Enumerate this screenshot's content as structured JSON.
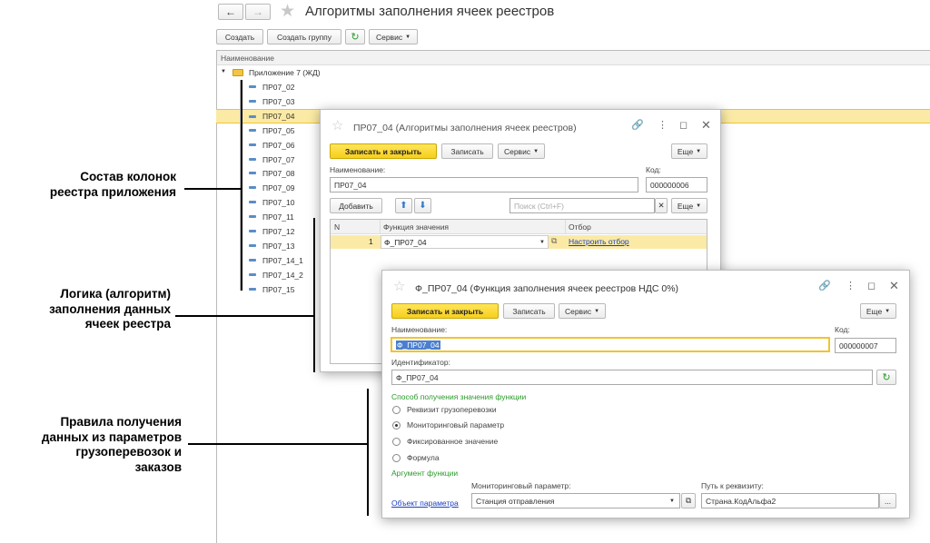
{
  "main": {
    "title": "Алгоритмы заполнения ячеек реестров",
    "buttons": {
      "create": "Создать",
      "create_group": "Создать группу",
      "service": "Сервис"
    },
    "column_header": "Наименование",
    "group_label": "Приложение 7 (ЖД)",
    "rows": [
      "ПР07_02",
      "ПР07_03",
      "ПР07_04",
      "ПР07_05",
      "ПР07_06",
      "ПР07_07",
      "ПР07_08",
      "ПР07_09",
      "ПР07_10",
      "ПР07_11",
      "ПР07_12",
      "ПР07_13",
      "ПР07_14_1",
      "ПР07_14_2",
      "ПР07_15"
    ],
    "selected_row": "ПР07_04"
  },
  "captions": {
    "c1": "Состав колонок\nреестра  приложения",
    "c2": "Логика (алгоритм)\nзаполнения данных\nячеек реестра",
    "c3": "Правила получения\nданных из параметров\nгрузоперевозок и\nзаказов"
  },
  "dialog1": {
    "title": "ПР07_04 (Алгоритмы заполнения ячеек реестров)",
    "buttons": {
      "save_close": "Записать и закрыть",
      "save": "Записать",
      "service": "Сервис",
      "more": "Еще",
      "add": "Добавить",
      "more2": "Еще"
    },
    "name_label": "Наименование:",
    "name_value": "ПР07_04",
    "code_label": "Код:",
    "code_value": "000000006",
    "search_placeholder": "Поиск (Ctrl+F)",
    "table": {
      "headers": [
        "N",
        "Функция значения",
        "Отбор"
      ],
      "row": {
        "n": "1",
        "func": "Ф_ПР07_04",
        "filter": "Настроить отбор"
      }
    }
  },
  "dialog2": {
    "title": "Ф_ПР07_04 (Функция заполнения ячеек реестров НДС 0%)",
    "buttons": {
      "save_close": "Записать и закрыть",
      "save": "Записать",
      "service": "Сервис",
      "more": "Еще",
      "params_link": "Объект параметра"
    },
    "name_label": "Наименование:",
    "name_value": "Ф_ПР07_04",
    "code_label": "Код:",
    "code_value": "000000007",
    "id_label": "Идентификатор:",
    "id_value": "Ф_ПР07_04",
    "method_label": "Способ получения значения функции",
    "options": [
      "Реквизит грузоперевозки",
      "Мониторинговый параметр",
      "Фиксированное значение",
      "Формула"
    ],
    "selected_option": 1,
    "arg_label": "Аргумент функции",
    "monitor_label": "Мониторинговый параметр:",
    "monitor_value": "Станция отправления",
    "path_label": "Путь к реквизиту:",
    "path_value": "Страна.КодАльфа2"
  }
}
